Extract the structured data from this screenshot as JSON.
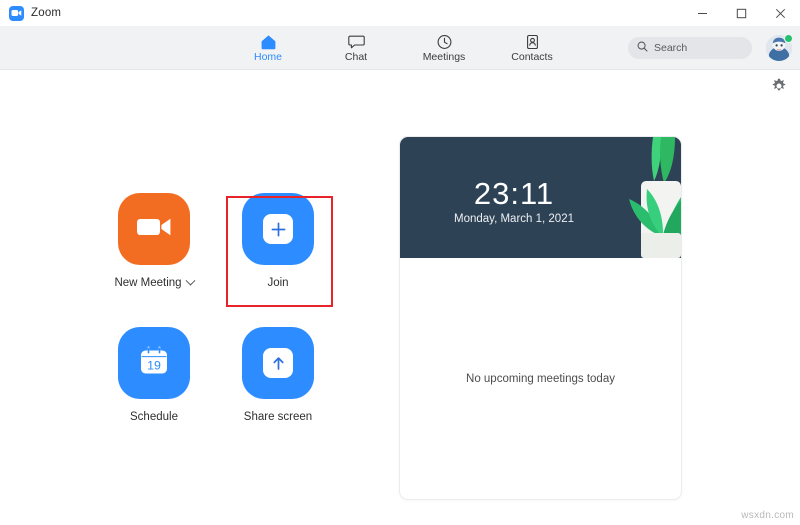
{
  "window": {
    "title": "Zoom",
    "app_icon": "zoom-camera-icon",
    "controls": {
      "minimize": "minimize-icon",
      "maximize": "maximize-icon",
      "close": "close-icon"
    }
  },
  "navbar": {
    "tabs": [
      {
        "label": "Home",
        "icon": "home-icon",
        "active": true
      },
      {
        "label": "Chat",
        "icon": "chat-bubble-icon",
        "active": false
      },
      {
        "label": "Meetings",
        "icon": "clock-icon",
        "active": false
      },
      {
        "label": "Contacts",
        "icon": "contact-card-icon",
        "active": false
      }
    ],
    "search": {
      "placeholder": "Search",
      "value": "",
      "icon": "search-icon"
    },
    "avatar": {
      "name": "user-avatar",
      "status": "available",
      "status_color": "#25c16f"
    }
  },
  "settings": {
    "icon": "gear-icon",
    "label": "Settings"
  },
  "actions": [
    {
      "label": "New Meeting",
      "icon": "video-camera-icon",
      "color": "#f26d21",
      "has_dropdown": true,
      "highlighted": false
    },
    {
      "label": "Join",
      "icon": "plus-icon",
      "color": "#2d8cff",
      "has_dropdown": false,
      "highlighted": true
    },
    {
      "label": "Schedule",
      "icon": "calendar-icon",
      "color": "#2d8cff",
      "has_dropdown": false,
      "highlighted": false,
      "calendar_day": "19"
    },
    {
      "label": "Share screen",
      "icon": "arrow-up-icon",
      "color": "#2d8cff",
      "has_dropdown": false,
      "highlighted": false
    }
  ],
  "highlight": {
    "target": "Join",
    "color": "#e8232a"
  },
  "meeting_panel": {
    "clock_time": "23:11",
    "clock_date": "Monday, March 1, 2021",
    "banner_color": "#2e4256",
    "decoration": "potted-plant-illustration",
    "empty_state": "No upcoming meetings today"
  },
  "watermark": "wsxdn.com"
}
